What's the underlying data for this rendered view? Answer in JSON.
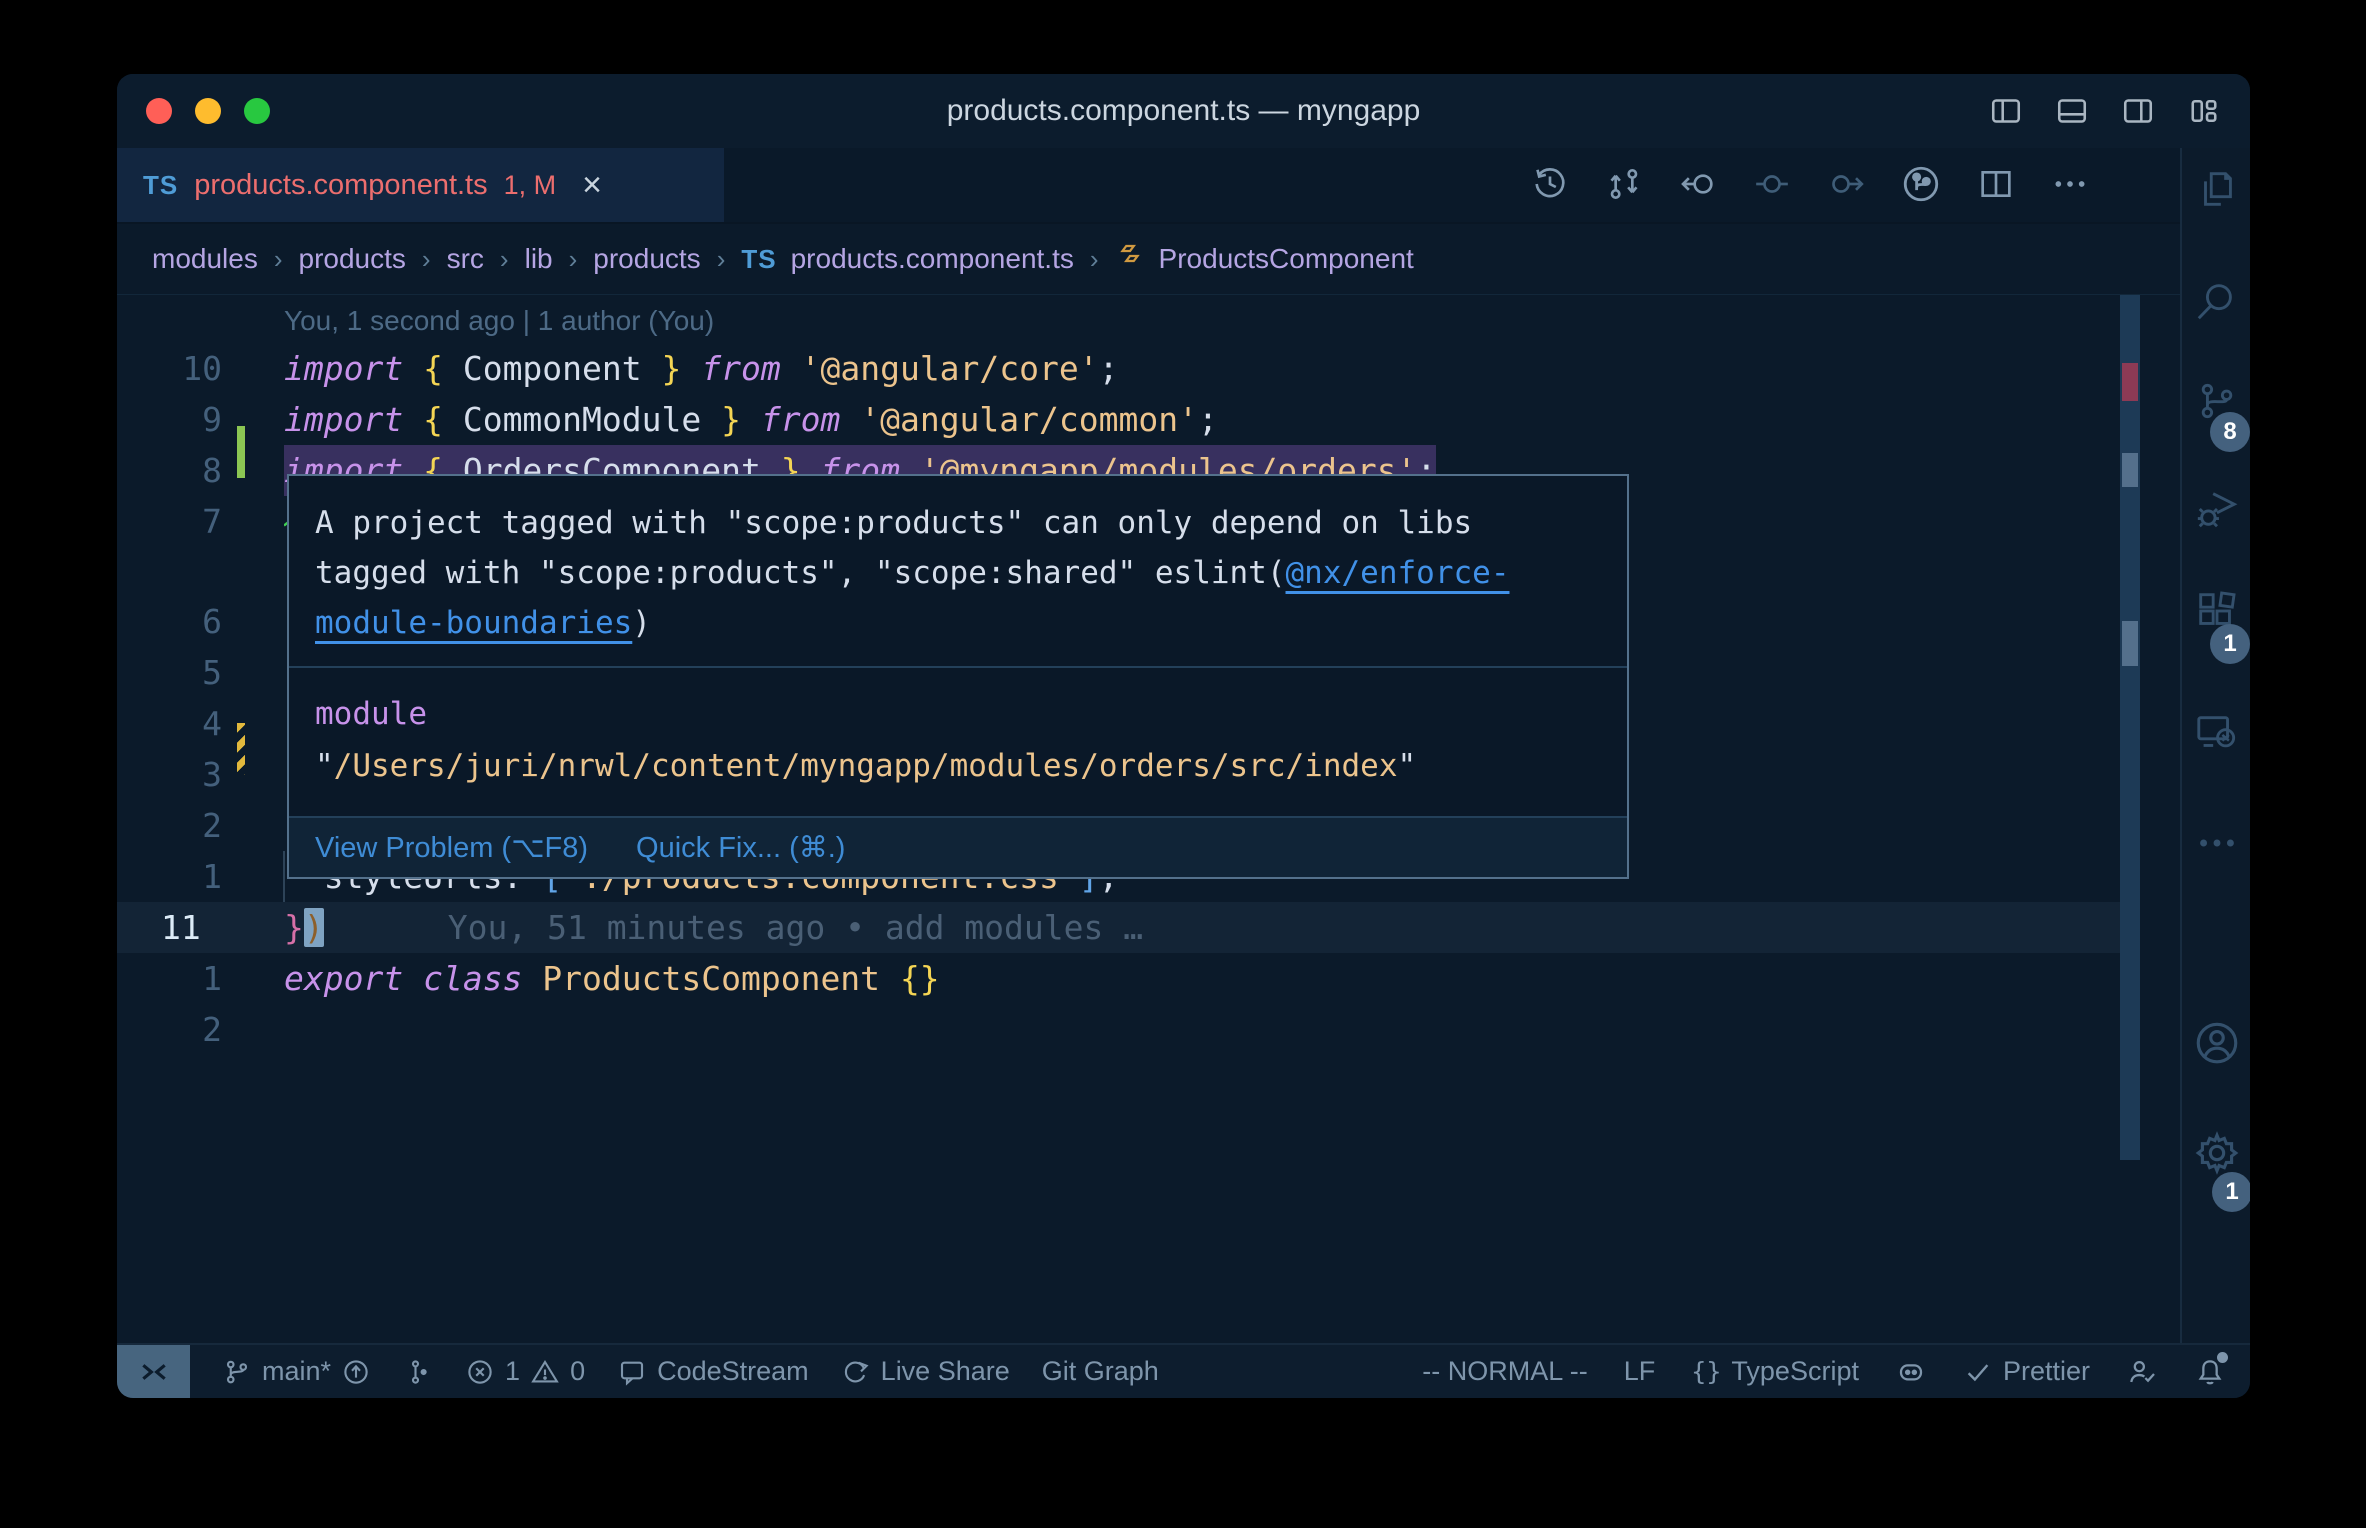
{
  "window": {
    "title": "products.component.ts — myngapp"
  },
  "colors": {
    "accent_link": "#4191e8",
    "tab_error": "#ec6e6e",
    "added": "#8cc653",
    "modified": "#e2b93d",
    "squiggle": "#3ecf52",
    "error_mark": "#8c3a55"
  },
  "titlebar_icons": [
    "toggle-primary-sidebar",
    "toggle-panel",
    "toggle-secondary-sidebar",
    "customize-layout"
  ],
  "tab": {
    "file_type": "TS",
    "label": "products.component.ts",
    "badges": "1, M",
    "close": "×"
  },
  "editor_actions": [
    "local-history",
    "compare-changes",
    "navigate-previous-change",
    "previous-change",
    "next-change",
    "gitlens-graph",
    "split-editor",
    "more-actions"
  ],
  "breadcrumb": {
    "separator": "›",
    "folders": [
      "modules",
      "products",
      "src",
      "lib",
      "products"
    ],
    "file": {
      "icon": "TS",
      "label": "products.component.ts"
    },
    "symbol": {
      "icon": "class",
      "label": "ProductsComponent"
    }
  },
  "blame_header": "You, 1 second ago | 1 author (You)",
  "code": {
    "rows": [
      {
        "num": "10",
        "tokens": [
          {
            "t": "import ",
            "c": "kw"
          },
          {
            "t": "{ ",
            "c": "br"
          },
          {
            "t": "Component",
            "c": "id"
          },
          {
            "t": " }",
            "c": "br"
          },
          {
            "t": " from ",
            "c": "kw"
          },
          {
            "t": "'@angular/core'",
            "c": "str"
          },
          {
            "t": ";",
            "c": "pu"
          }
        ]
      },
      {
        "num": "9",
        "tokens": [
          {
            "t": "import ",
            "c": "kw"
          },
          {
            "t": "{ ",
            "c": "br"
          },
          {
            "t": "CommonModule",
            "c": "id"
          },
          {
            "t": " }",
            "c": "br"
          },
          {
            "t": " from ",
            "c": "kw"
          },
          {
            "t": "'@angular/common'",
            "c": "str"
          },
          {
            "t": ";",
            "c": "pu"
          }
        ]
      },
      {
        "num": "8",
        "marker": "added",
        "selected": true,
        "squiggle": true,
        "tokens": [
          {
            "t": "import ",
            "c": "kw"
          },
          {
            "t": "{ ",
            "c": "br"
          },
          {
            "t": "OrdersComponent",
            "c": "id"
          },
          {
            "t": " }",
            "c": "br"
          },
          {
            "t": " from ",
            "c": "kw"
          },
          {
            "t": "'@myngapp/modules/orders'",
            "c": "str"
          },
          {
            "t": ";",
            "c": "pu"
          }
        ]
      },
      {
        "num": "7",
        "tokens": []
      },
      {
        "num": "6",
        "tokens": []
      },
      {
        "num": "5",
        "tokens": []
      },
      {
        "num": "4",
        "tokens": []
      },
      {
        "num": "3",
        "marker": "modified",
        "tokens": []
      },
      {
        "num": "2",
        "tokens": []
      },
      {
        "num": "1",
        "guide": true,
        "tokens": [
          {
            "t": "  ",
            "c": "pu"
          },
          {
            "t": "styleUrls",
            "c": "id"
          },
          {
            "t": ": ",
            "c": "pu"
          },
          {
            "t": "[",
            "c": "sq"
          },
          {
            "t": "'./products.component.css'",
            "c": "str"
          },
          {
            "t": "]",
            "c": "sq"
          },
          {
            "t": ",",
            "c": "pu"
          }
        ]
      },
      {
        "num": "11",
        "current": true,
        "trail": "You, 51 minutes ago • add modules …",
        "tokens": [
          {
            "t": "}",
            "c": "pink"
          },
          {
            "t": ")",
            "c": "cur"
          }
        ]
      },
      {
        "num": "1",
        "tokens": [
          {
            "t": "export",
            "c": "kw"
          },
          {
            "t": " class ",
            "c": "kw"
          },
          {
            "t": "ProductsComponent",
            "c": "cls"
          },
          {
            "t": " ",
            "c": "pu"
          },
          {
            "t": "{}",
            "c": "br"
          }
        ]
      },
      {
        "num": "2",
        "tokens": []
      }
    ]
  },
  "hover": {
    "line1": "A project tagged with \"scope:products\" can only depend on libs",
    "line2_pre": "tagged with \"scope:products\", \"scope:shared\" eslint(",
    "line2_link": "@nx/enforce-",
    "line3_link": "module-boundaries",
    "line3_post": ")",
    "module_label": "module",
    "module_quote_open": "\"",
    "module_path": "/Users/juri/nrwl/content/myngapp/modules/orders/src/index",
    "module_quote_close": "\"",
    "action_view": "View Problem (⌥F8)",
    "action_quickfix": "Quick Fix... (⌘.)"
  },
  "status_bar": {
    "branch": "main*",
    "error_count": "1",
    "warning_count": "0",
    "codestream": "CodeStream",
    "live_share": "Live Share",
    "git_graph": "Git Graph",
    "vim_mode": "-- NORMAL --",
    "eol": "LF",
    "language_braces": "{}",
    "language": "TypeScript",
    "prettier": "Prettier"
  },
  "activity_bar": {
    "items": [
      {
        "name": "explorer"
      },
      {
        "name": "search"
      },
      {
        "name": "source-control",
        "badge": "8"
      },
      {
        "name": "run-debug"
      },
      {
        "name": "extensions",
        "badge": "1"
      },
      {
        "name": "remote-explorer"
      },
      {
        "name": "more"
      },
      {
        "name": "accounts"
      },
      {
        "name": "settings",
        "badge": "1"
      }
    ]
  }
}
